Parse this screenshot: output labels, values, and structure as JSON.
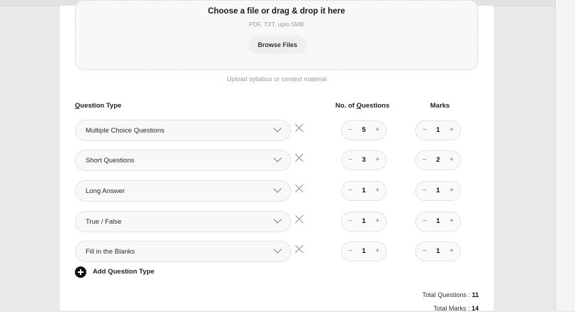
{
  "upload": {
    "title": "Choose a file or drag & drop it here",
    "subtitle": "PDF, TXT, upto 5MB",
    "browse_label": "Browse Files",
    "hint": "Upload syllabus or context material"
  },
  "table": {
    "col_type_prefix": "Q",
    "col_type_rest": "uestion Type",
    "col_count_prefix": "No. of ",
    "col_count_u": "Q",
    "col_count_rest": "uestions",
    "col_marks": "Marks"
  },
  "rows": [
    {
      "type": "Multiple Choice Questions",
      "count": "5",
      "marks": "1"
    },
    {
      "type": "Short Questions",
      "count": "3",
      "marks": "2"
    },
    {
      "type": "Long Answer",
      "count": "1",
      "marks": "1"
    },
    {
      "type": "True / False",
      "count": "1",
      "marks": "1"
    },
    {
      "type": "Fill in the Blanks",
      "count": "1",
      "marks": "1"
    }
  ],
  "stepper": {
    "minus": "−",
    "plus": "+"
  },
  "add_label": "Add Question Type",
  "totals": {
    "questions_label": "Total Questions : ",
    "questions_value": "11",
    "marks_label": "Total Marks : ",
    "marks_value": "14"
  }
}
